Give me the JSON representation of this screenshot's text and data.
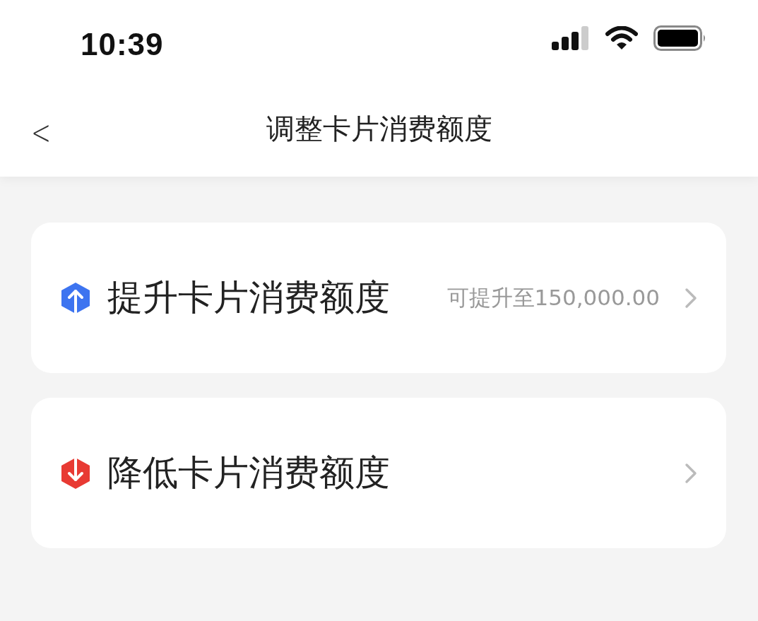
{
  "status_bar": {
    "time": "10:39"
  },
  "nav": {
    "back": "<",
    "title": "调整卡片消费额度"
  },
  "options": [
    {
      "kind": "raise",
      "label": "提升卡片消费额度",
      "hint": "可提升至150,000.00"
    },
    {
      "kind": "lower",
      "label": "降低卡片消费额度"
    }
  ]
}
